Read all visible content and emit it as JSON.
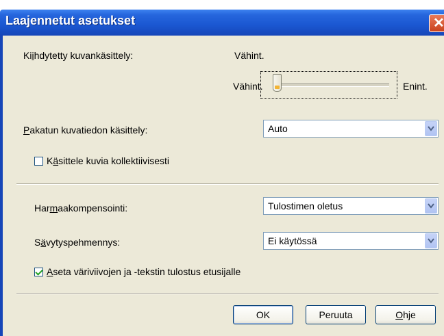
{
  "window": {
    "title": "Laajennetut asetukset",
    "close_glyph": "✕"
  },
  "enhanced": {
    "label_pre": "Ki",
    "label_ul": "i",
    "label_post": "hdytetty kuvankäsittely:",
    "current_value": "Vähint.",
    "min_label": "Vähint.",
    "max_label": "Enint.",
    "level": 0
  },
  "compressed": {
    "label_ul": "P",
    "label_post": "akatun kuvatiedon käsittely:",
    "value": "Auto"
  },
  "collective": {
    "label_pre": "K",
    "label_ul": "ä",
    "label_post": "sittele kuvia kollektiivisesti",
    "checked": false
  },
  "gray": {
    "label_pre": "Har",
    "label_ul": "m",
    "label_post": "aakompensointi:",
    "value": "Tulostimen oletus"
  },
  "smoothing": {
    "label_pre": "S",
    "label_ul": "ä",
    "label_post": "vytyspehmennys:",
    "value": "Ei käytössä"
  },
  "color_priority": {
    "label_ul": "A",
    "label_post": "seta väriviivojen ja -tekstin tulostus etusijalle",
    "checked": true
  },
  "buttons": {
    "ok": "OK",
    "cancel": "Peruuta",
    "help_ul": "O",
    "help_post": "hje"
  },
  "icons": {
    "dropdown": "chevron-down-icon",
    "close": "close-icon"
  }
}
